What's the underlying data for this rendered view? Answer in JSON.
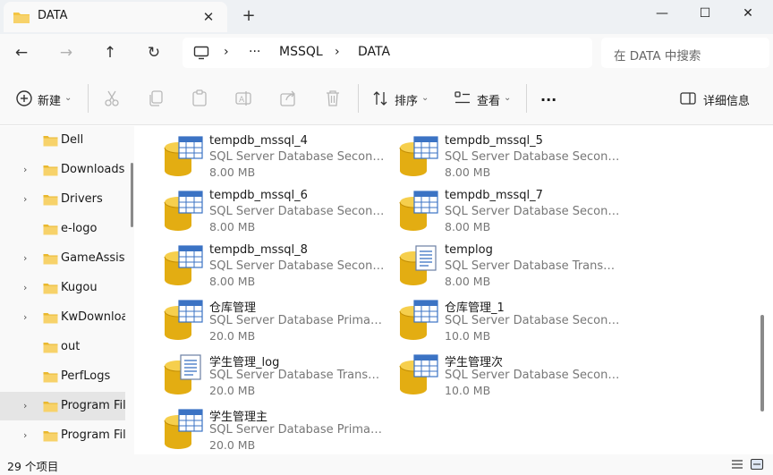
{
  "window": {
    "tab_title": "DATA",
    "tab_close": "✕",
    "new_tab": "+",
    "minimize": "—",
    "maximize": "☐",
    "close": "✕"
  },
  "nav": {
    "back": "←",
    "forward": "→",
    "up": "↑",
    "refresh": "↻"
  },
  "address": {
    "sep1": "›",
    "more": "···",
    "crumb1": "MSSQL",
    "sep2": "›",
    "crumb2": "DATA"
  },
  "search": {
    "placeholder": "在 DATA 中搜索"
  },
  "toolbar": {
    "new_label": "新建",
    "sort_label": "排序",
    "view_label": "查看",
    "more_label": "···",
    "details_label": "详细信息",
    "caret": "⌄"
  },
  "sidebar": {
    "items": [
      {
        "label": "Dell",
        "chevron": ""
      },
      {
        "label": "Downloads",
        "chevron": "›"
      },
      {
        "label": "Drivers",
        "chevron": "›"
      },
      {
        "label": "e-logo",
        "chevron": ""
      },
      {
        "label": "GameAssistant",
        "chevron": "›"
      },
      {
        "label": "Kugou",
        "chevron": "›"
      },
      {
        "label": "KwDownload",
        "chevron": "›"
      },
      {
        "label": "out",
        "chevron": ""
      },
      {
        "label": "PerfLogs",
        "chevron": ""
      },
      {
        "label": "Program Files",
        "chevron": "›"
      },
      {
        "label": "Program Files",
        "chevron": "›"
      }
    ]
  },
  "files": [
    {
      "name": "tempdb_mssql_4",
      "type": "SQL Server Database Seconda...",
      "size": "8.00 MB"
    },
    {
      "name": "tempdb_mssql_5",
      "type": "SQL Server Database Seconda...",
      "size": "8.00 MB"
    },
    {
      "name": "tempdb_mssql_6",
      "type": "SQL Server Database Seconda...",
      "size": "8.00 MB"
    },
    {
      "name": "tempdb_mssql_7",
      "type": "SQL Server Database Seconda...",
      "size": "8.00 MB"
    },
    {
      "name": "tempdb_mssql_8",
      "type": "SQL Server Database Seconda...",
      "size": "8.00 MB"
    },
    {
      "name": "templog",
      "type": "SQL Server Database Transacti...",
      "size": "8.00 MB"
    },
    {
      "name": "仓库管理",
      "type": "SQL Server Database Primary ...",
      "size": "20.0 MB"
    },
    {
      "name": "仓库管理_1",
      "type": "SQL Server Database Seconda...",
      "size": "10.0 MB"
    },
    {
      "name": "学生管理_log",
      "type": "SQL Server Database Transacti...",
      "size": "20.0 MB"
    },
    {
      "name": "学生管理次",
      "type": "SQL Server Database Seconda...",
      "size": "10.0 MB"
    },
    {
      "name": "学生管理主",
      "type": "SQL Server Database Primary ...",
      "size": "20.0 MB"
    }
  ],
  "status": {
    "count": "29 个项目"
  },
  "colors": {
    "folder": "#f4c542",
    "db_gold": "#e3ad12",
    "grid_blue": "#3b73c4",
    "accent": "#0067c0"
  }
}
